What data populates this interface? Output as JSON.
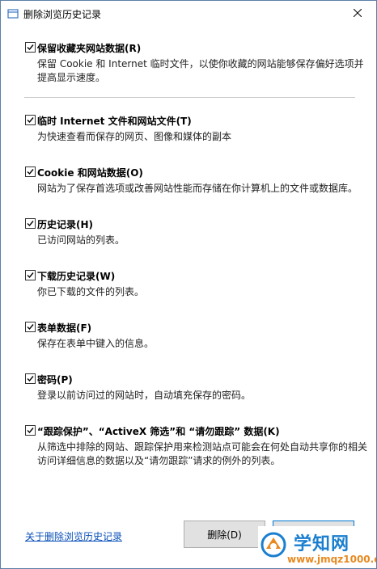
{
  "window": {
    "title": "删除浏览历史记录",
    "close_icon": "close-icon"
  },
  "options": [
    {
      "checked": true,
      "title": "保留收藏夹网站数据(R)",
      "description": "保留 Cookie 和 Internet 临时文件，以使你收藏的网站能够保存偏好选项并提高显示速度。"
    },
    {
      "checked": true,
      "title": "临时 Internet 文件和网站文件(T)",
      "description": "为快速查看而保存的网页、图像和媒体的副本"
    },
    {
      "checked": true,
      "title": "Cookie 和网站数据(O)",
      "description": "网站为了保存首选项或改善网站性能而存储在你计算机上的文件或数据库。"
    },
    {
      "checked": true,
      "title": "历史记录(H)",
      "description": "已访问网站的列表。"
    },
    {
      "checked": true,
      "title": "下载历史记录(W)",
      "description": "你已下载的文件的列表。"
    },
    {
      "checked": true,
      "title": "表单数据(F)",
      "description": "保存在表单中键入的信息。"
    },
    {
      "checked": true,
      "title": "密码(P)",
      "description": "登录以前访问过的网站时，自动填充保存的密码。"
    },
    {
      "checked": true,
      "title": "“跟踪保护”、“ActiveX 筛选”和 “请勿跟踪” 数据(K)",
      "description": "从筛选中排除的网站、跟踪保护用来检测站点可能会在何处自动共享你的相关访问详细信息的数据以及“请勿跟踪”请求的例外的列表。"
    }
  ],
  "footer": {
    "link": "关于删除浏览历史记录",
    "delete_button": "删除(D)",
    "cancel_button": ""
  },
  "watermark": {
    "title": "学知网",
    "url": "www.jmqz1000.com"
  },
  "colors": {
    "link": "#0a4fb8",
    "watermark_blue": "#1a7fcf",
    "watermark_orange": "#e8891f",
    "focus_border": "#0078d7"
  }
}
